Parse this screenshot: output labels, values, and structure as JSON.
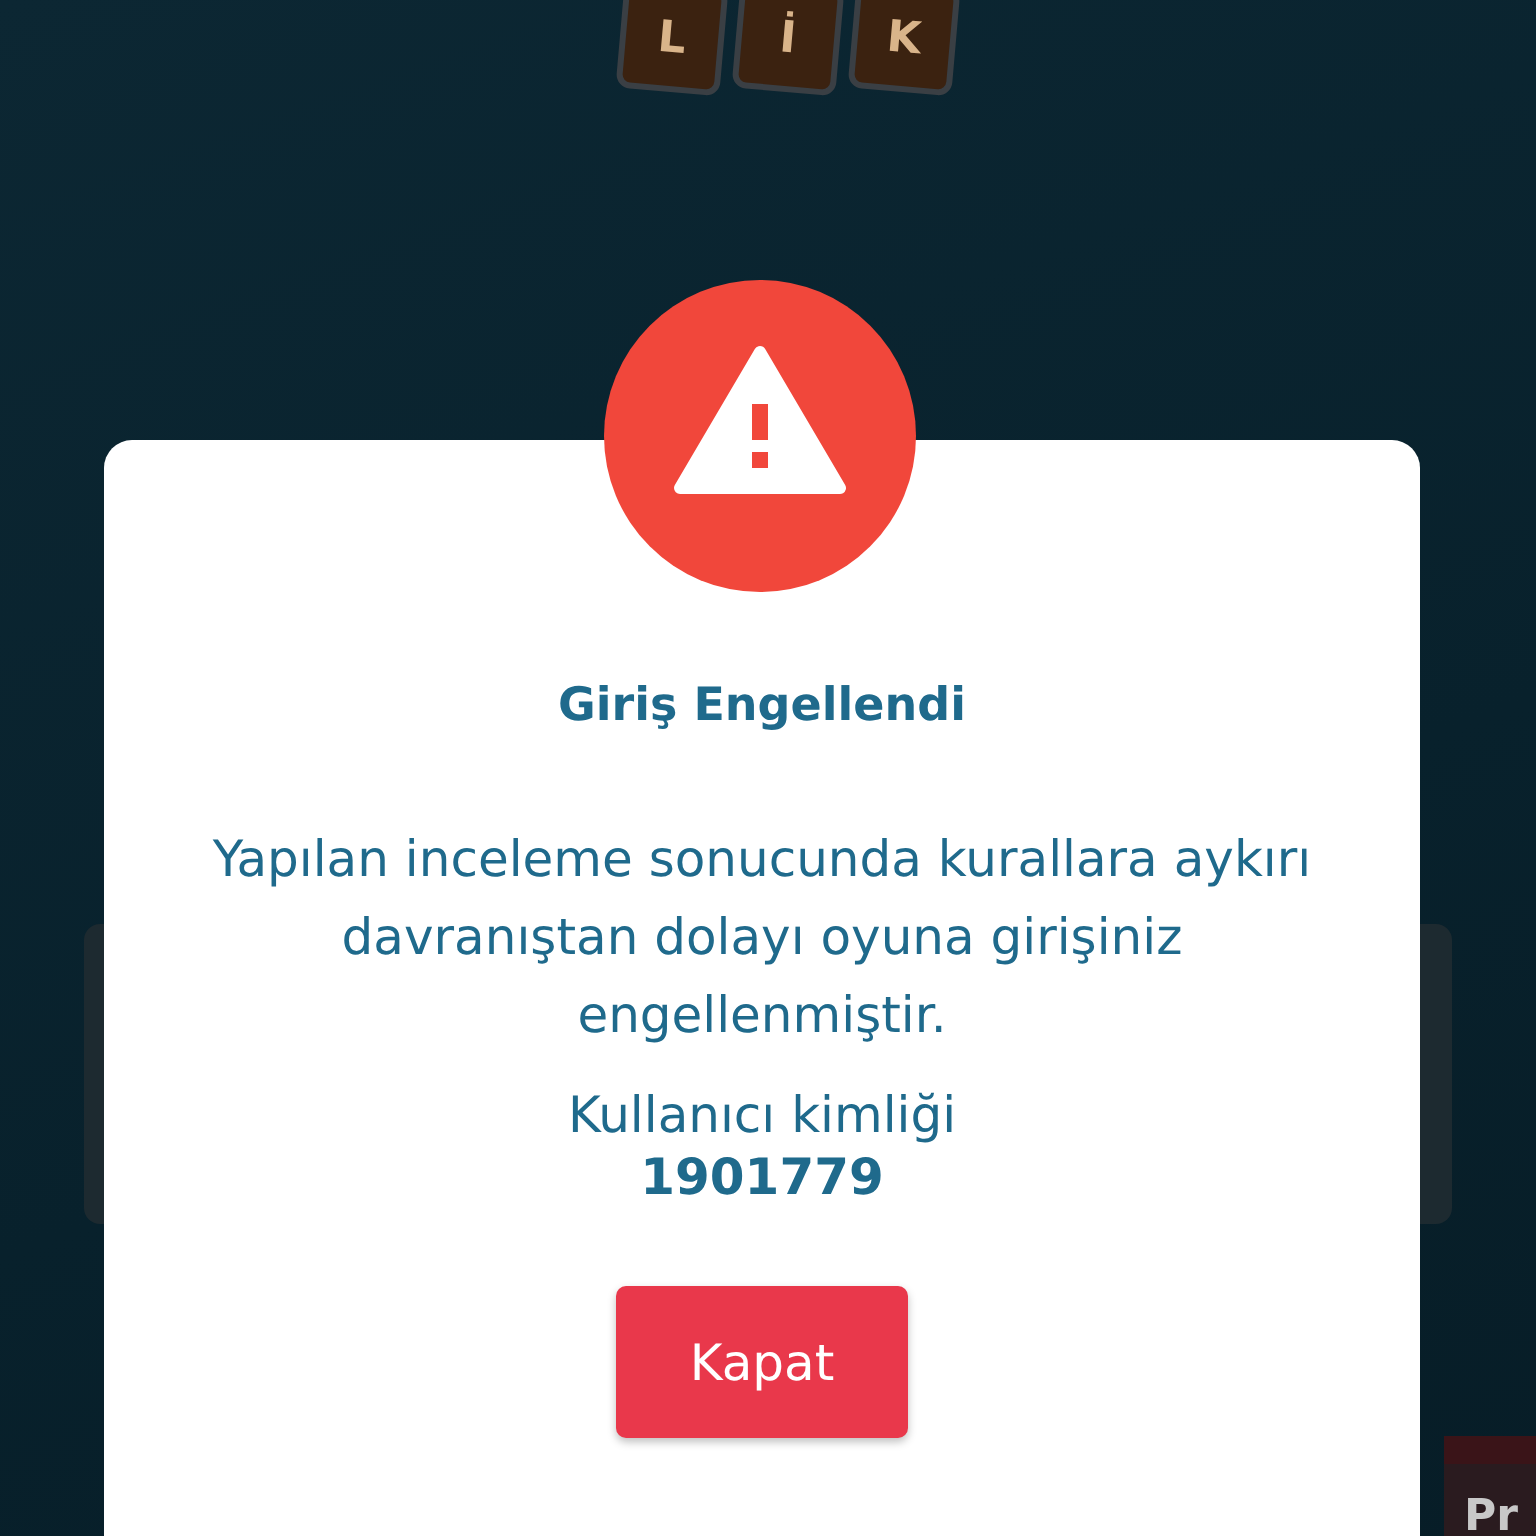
{
  "background": {
    "logo_tiles": [
      "L",
      "İ",
      "K"
    ],
    "corner_card": "Pr"
  },
  "dialog": {
    "title": "Giriş Engellendi",
    "message": "Yapılan inceleme sonucunda kurallara aykırı davranıştan dolayı oyuna girişiniz engellenmiştir.",
    "user_id_label": "Kullanıcı kimliği",
    "user_id": "1901779",
    "button": "Kapat"
  }
}
